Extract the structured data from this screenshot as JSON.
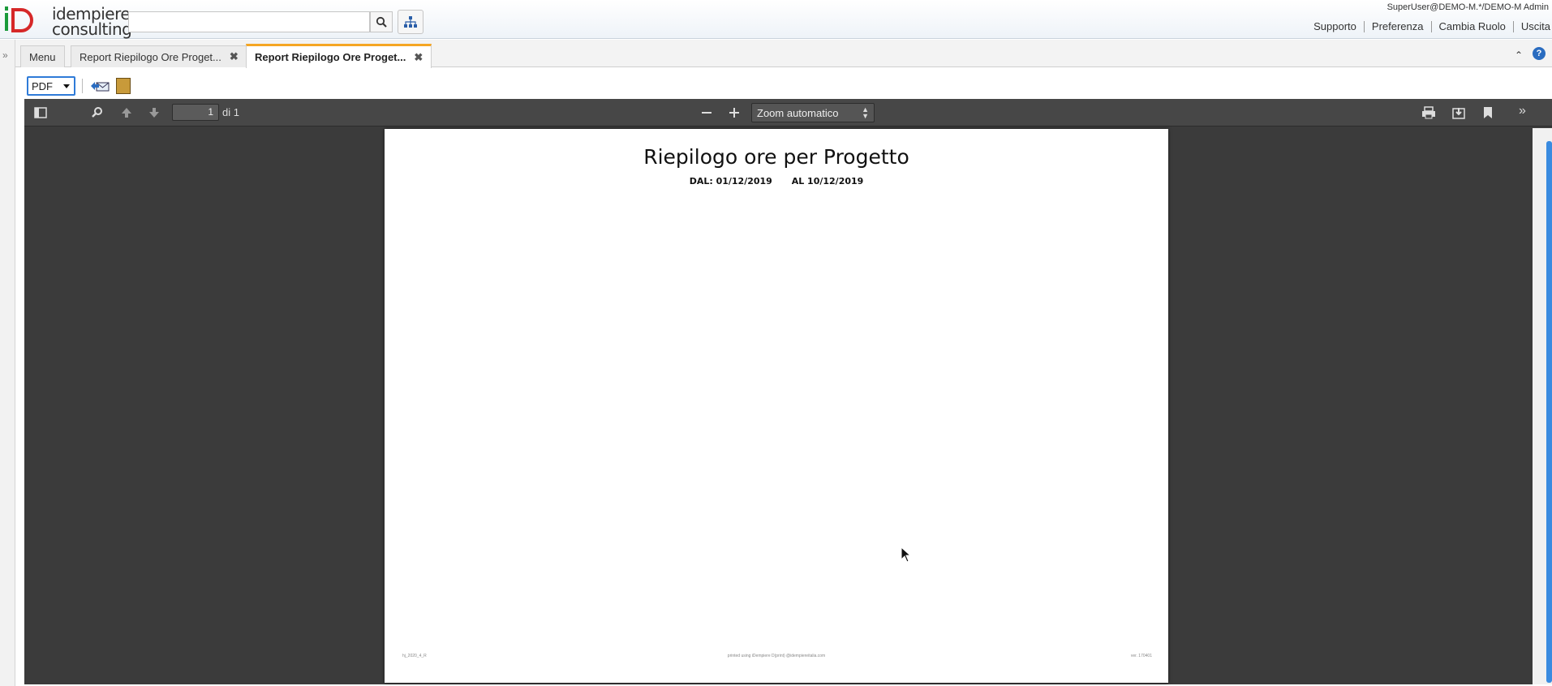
{
  "header": {
    "logo_text_line1": "idempiere",
    "logo_text_line2": "consulting",
    "search_placeholder": "",
    "user_info": "SuperUser@DEMO-M.*/DEMO-M Admin",
    "links": [
      "Supporto",
      "Preferenza",
      "Cambia Ruolo",
      "Uscita"
    ]
  },
  "tabs": [
    {
      "label": "Menu"
    },
    {
      "label": "Report Riepilogo Ore Proget..."
    },
    {
      "label": "Report Riepilogo Ore Proget..."
    }
  ],
  "report_toolbar": {
    "format": "PDF"
  },
  "viewer": {
    "page_number": "1",
    "page_total": "di 1",
    "zoom": "Zoom automatico"
  },
  "document": {
    "title": "Riepilogo ore per Progetto",
    "from_label": "DAL: 01/12/2019",
    "to_label": "AL 10/12/2019",
    "footer_left": "hj_2020_4_R",
    "footer_center": "printed using iDempiere D(print) @idempiereitalia.com",
    "footer_right": "ver. 170401"
  },
  "colors": {
    "accent_tab": "#f5a623",
    "viewer_bg": "#3b3b3b",
    "scroll_thumb": "#3a8be0"
  }
}
